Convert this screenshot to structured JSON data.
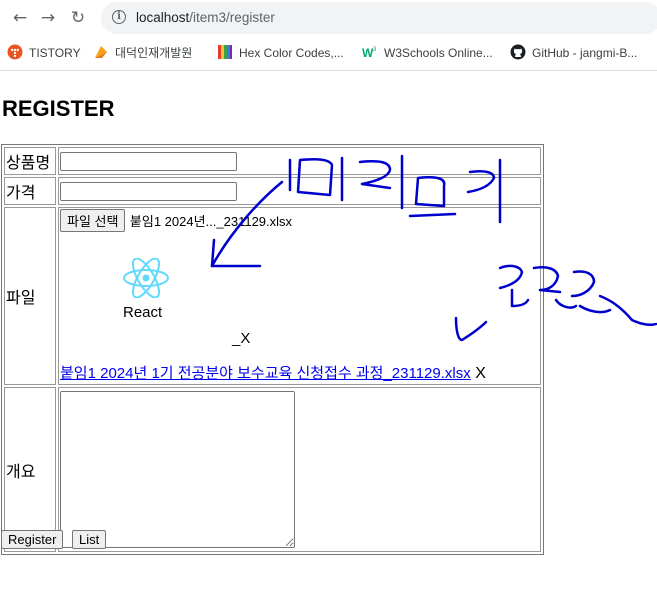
{
  "browser": {
    "url_host": "localhost",
    "url_path": "/item3/register",
    "bookmarks": [
      {
        "label": "TISTORY",
        "icon": "tistory-icon"
      },
      {
        "label": "대덕인재개발원",
        "icon": "bookmark-feather-icon"
      },
      {
        "label": "Hex Color Codes,...",
        "icon": "color-palette-icon"
      },
      {
        "label": "W3Schools Online...",
        "icon": "w3schools-icon"
      },
      {
        "label": "GitHub - jangmi-B...",
        "icon": "github-icon"
      }
    ]
  },
  "page": {
    "title": "REGISTER",
    "fields": {
      "name_label": "상품명",
      "name_value": "",
      "price_label": "가격",
      "price_value": "",
      "file_label": "파일",
      "file_button": "파일 선택",
      "file_selected": "붙임1 2024년..._231129.xlsx",
      "preview_caption": "React",
      "remove_label": "_X",
      "attachment_link": "붙임1 2024년 1기 전공분야 보수교육 신청접수 과정_231129.xlsx",
      "attachment_delete": "X",
      "summary_label": "개요",
      "summary_value": ""
    },
    "buttons": {
      "register": "Register",
      "list": "List"
    }
  },
  "colors": {
    "annotation_ink": "#0000cc",
    "react_logo": "#61dafb",
    "link": "#0000ee"
  }
}
